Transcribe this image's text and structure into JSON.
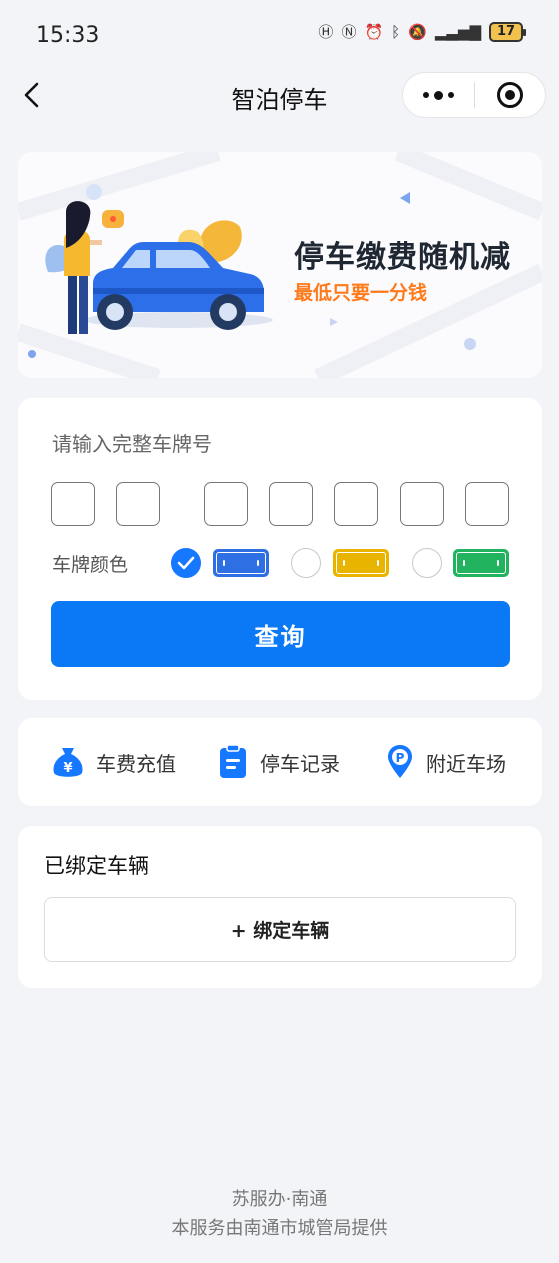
{
  "status_bar": {
    "time": "15:33",
    "battery": "17"
  },
  "nav": {
    "title": "智泊停车"
  },
  "banner": {
    "title": "停车缴费随机减",
    "subtitle": "最低只要一分钱"
  },
  "plate_form": {
    "prompt": "请输入完整车牌号",
    "color_label": "车牌颜色",
    "plate_colors": [
      {
        "name": "blue",
        "hex": "#2f6fe4",
        "selected": true
      },
      {
        "name": "yellow",
        "hex": "#e8b400",
        "selected": false
      },
      {
        "name": "green",
        "hex": "#22b35e",
        "selected": false
      }
    ],
    "query_label": "查询"
  },
  "actions": [
    {
      "label": "车费充值",
      "icon": "money-bag-icon"
    },
    {
      "label": "停车记录",
      "icon": "clipboard-icon"
    },
    {
      "label": "附近车场",
      "icon": "parking-pin-icon"
    }
  ],
  "bound": {
    "title": "已绑定车辆",
    "bind_label": "+ 绑定车辆"
  },
  "footer": {
    "line1": "苏服办·南通",
    "line2": "本服务由南通市城管局提供"
  },
  "colors": {
    "primary": "#0b78f5",
    "accent_orange": "#ff7a1a",
    "background": "#f3f4f7"
  }
}
